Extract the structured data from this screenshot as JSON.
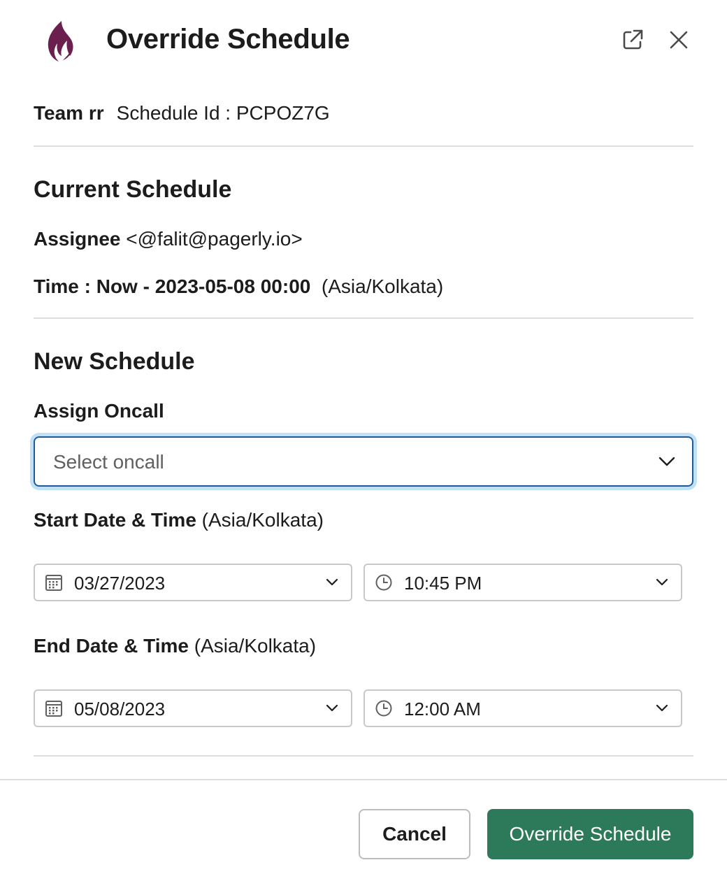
{
  "header": {
    "title": "Override Schedule",
    "logo_icon": "pagerly-flame-icon",
    "logo_color": "#6b1f4f"
  },
  "meta": {
    "team": "Team rr",
    "schedule_id": "Schedule Id : PCPOZ7G"
  },
  "current_schedule": {
    "title": "Current Schedule",
    "assignee_label": "Assignee",
    "assignee_value": "<@falit@pagerly.io>",
    "time_label": "Time : Now - 2023-05-08 00:00",
    "time_zone": "(Asia/Kolkata)"
  },
  "new_schedule": {
    "title": "New Schedule",
    "assign_label": "Assign Oncall",
    "assign_placeholder": "Select oncall",
    "start_label": "Start Date & Time",
    "start_tz": "(Asia/Kolkata)",
    "start_date": "03/27/2023",
    "start_time": "10:45 PM",
    "end_label": "End Date & Time",
    "end_tz": "(Asia/Kolkata)",
    "end_date": "05/08/2023",
    "end_time": "12:00 AM"
  },
  "footer": {
    "cancel_label": "Cancel",
    "submit_label": "Override Schedule",
    "submit_color": "#2d7a5a"
  }
}
